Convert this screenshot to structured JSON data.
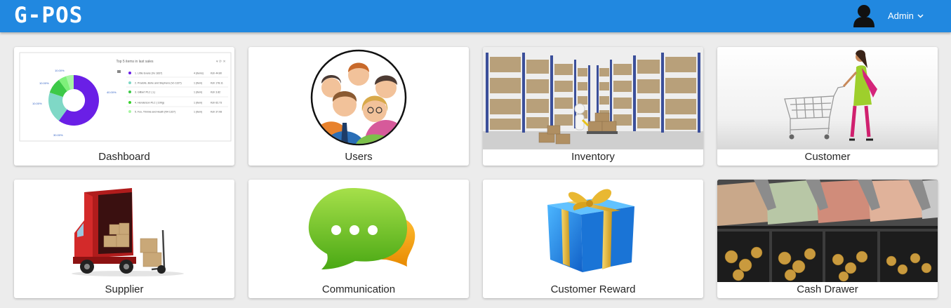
{
  "app": {
    "title": "G-POS"
  },
  "header": {
    "user_label": "Admin"
  },
  "tiles": [
    {
      "label": "Dashboard"
    },
    {
      "label": "Users"
    },
    {
      "label": "Inventory"
    },
    {
      "label": "Customer"
    },
    {
      "label": "Supplier"
    },
    {
      "label": "Communication"
    },
    {
      "label": "Customer Reward"
    },
    {
      "label": "Cash Drawer"
    }
  ],
  "dashboard_preview": {
    "title": "Top 5 items in last sales",
    "rows": [
      {
        "name": "1. Little Evans (Vo 1837)",
        "qty": "4 (items)",
        "amount": "Ksh 44.80"
      },
      {
        "name": "2. Pradofe, Bohe and Stephens (Vo 1327)",
        "qty": "1 (item)",
        "amount": "Ksh 178.11"
      },
      {
        "name": "3. Gilbert PLC ( L)",
        "qty": "1 (item)",
        "amount": "Ksh 3.82"
      },
      {
        "name": "4. Henderson PLC ( 100g)",
        "qty": "1 (item)",
        "amount": "Ksh 62.73"
      },
      {
        "name": "5. Fox, Timmie and Heath (N4 1327)",
        "qty": "1 (item)",
        "amount": "Ksh 37.08"
      }
    ],
    "slice_labels": [
      "40.00%",
      "30.00%",
      "10.00%",
      "10.00%",
      "10.00%"
    ]
  },
  "colors": {
    "topbar": "#2188e0",
    "background": "#ececec"
  }
}
